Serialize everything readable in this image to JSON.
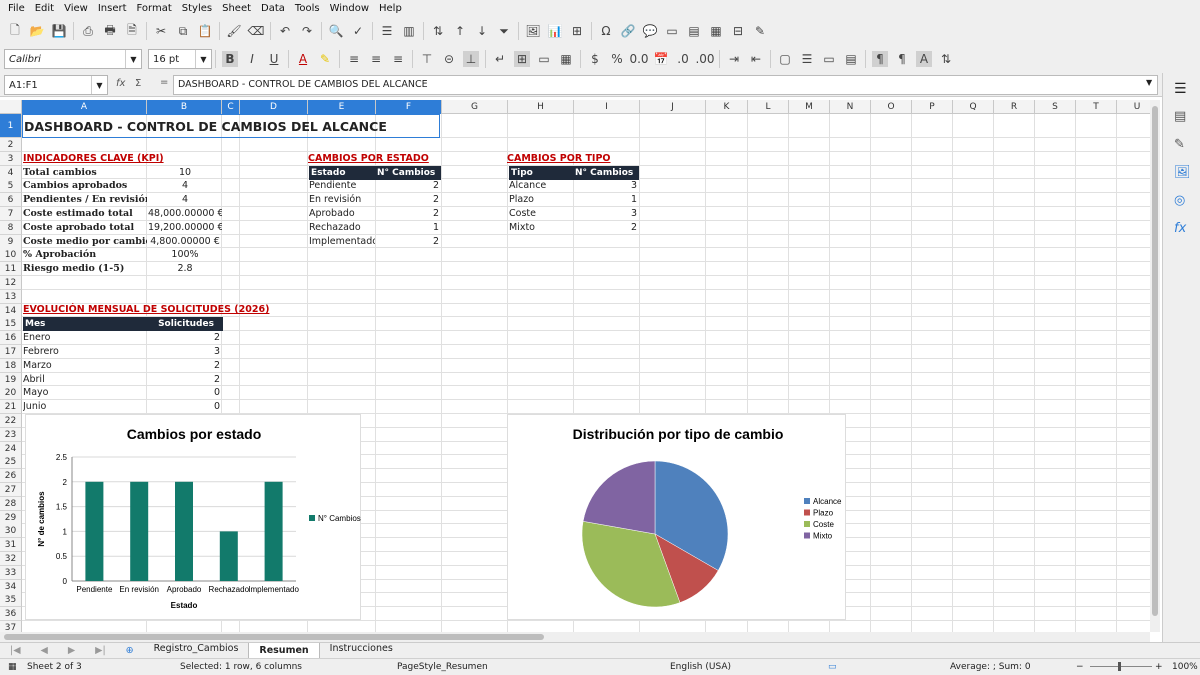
{
  "menu": [
    "File",
    "Edit",
    "View",
    "Insert",
    "Format",
    "Styles",
    "Sheet",
    "Data",
    "Tools",
    "Window",
    "Help"
  ],
  "font": {
    "name": "Calibri",
    "size": "16 pt"
  },
  "formula": {
    "namebox": "A1:F1",
    "content": "DASHBOARD - CONTROL DE CAMBIOS DEL ALCANCE"
  },
  "columns": [
    "A",
    "B",
    "C",
    "D",
    "E",
    "F",
    "G",
    "H",
    "I",
    "J",
    "K",
    "L",
    "M",
    "N",
    "O",
    "P",
    "Q",
    "R",
    "S",
    "T",
    "U"
  ],
  "rows": [
    "1",
    "2",
    "3",
    "4",
    "5",
    "6",
    "7",
    "8",
    "9",
    "10",
    "11",
    "12",
    "13",
    "14",
    "15",
    "16",
    "17",
    "18",
    "19",
    "20",
    "21",
    "22",
    "23",
    "24",
    "25",
    "26",
    "27",
    "28",
    "29",
    "30",
    "31",
    "32",
    "33",
    "34",
    "35",
    "36",
    "37"
  ],
  "sheet": {
    "title": "DASHBOARD - CONTROL DE CAMBIOS DEL ALCANCE",
    "kpi_title": "INDICADORES CLAVE (KPI)",
    "kpis": [
      {
        "label": "Total cambios",
        "value": "10"
      },
      {
        "label": "Cambios aprobados",
        "value": "4"
      },
      {
        "label": "Pendientes / En revisión",
        "value": "4"
      },
      {
        "label": "Coste estimado total",
        "value": "48,000.00000 €"
      },
      {
        "label": "Coste aprobado total",
        "value": "19,200.00000 €"
      },
      {
        "label": "Coste medio por cambio",
        "value": "4,800.00000 €"
      },
      {
        "label": "% Aprobación",
        "value": "100%"
      },
      {
        "label": "Riesgo medio (1-5)",
        "value": "2.8"
      }
    ],
    "estado_title": "CAMBIOS POR ESTADO",
    "estado_headers": [
      "Estado",
      "N° Cambios"
    ],
    "estado_rows": [
      [
        "Pendiente",
        "2"
      ],
      [
        "En revisión",
        "2"
      ],
      [
        "Aprobado",
        "2"
      ],
      [
        "Rechazado",
        "1"
      ],
      [
        "Implementado",
        "2"
      ]
    ],
    "tipo_title": "CAMBIOS POR TIPO",
    "tipo_headers": [
      "Tipo",
      "N° Cambios"
    ],
    "tipo_rows": [
      [
        "Alcance",
        "3"
      ],
      [
        "Plazo",
        "1"
      ],
      [
        "Coste",
        "3"
      ],
      [
        "Mixto",
        "2"
      ]
    ],
    "evol_title": "EVOLUCIÓN MENSUAL DE SOLICITUDES (2026)",
    "evol_headers": [
      "Mes",
      "Solicitudes"
    ],
    "evol_rows": [
      [
        "Enero",
        "2"
      ],
      [
        "Febrero",
        "3"
      ],
      [
        "Marzo",
        "2"
      ],
      [
        "Abril",
        "2"
      ],
      [
        "Mayo",
        "0"
      ],
      [
        "Junio",
        "0"
      ]
    ]
  },
  "chart_data": [
    {
      "type": "bar",
      "title": "Cambios por estado",
      "categories": [
        "Pendiente",
        "En revisión",
        "Aprobado",
        "Rechazado",
        "Implementado"
      ],
      "series": [
        {
          "name": "N° Cambios",
          "values": [
            2,
            2,
            2,
            1,
            2
          ]
        }
      ],
      "xlabel": "Estado",
      "ylabel": "N° de cambios",
      "ylim": [
        0,
        2.5
      ],
      "yticks": [
        "0",
        "0.5",
        "1",
        "1.5",
        "2",
        "2.5"
      ],
      "color": "#127a6b",
      "legend": "right"
    },
    {
      "type": "pie",
      "title": "Distribución por tipo de cambio",
      "categories": [
        "Alcance",
        "Plazo",
        "Coste",
        "Mixto"
      ],
      "values": [
        3,
        1,
        3,
        2
      ],
      "colors": [
        "#4f81bd",
        "#c0504d",
        "#9bbb59",
        "#8064a2"
      ],
      "legend": "right"
    }
  ],
  "tabs": [
    "Registro_Cambios",
    "Resumen",
    "Instrucciones"
  ],
  "status": {
    "sheet": "Sheet 2 of 3",
    "selection": "Selected: 1 row, 6 columns",
    "pagestyle": "PageStyle_Resumen",
    "lang": "English (USA)",
    "sum": "Average: ; Sum: 0",
    "zoom": "100%"
  }
}
